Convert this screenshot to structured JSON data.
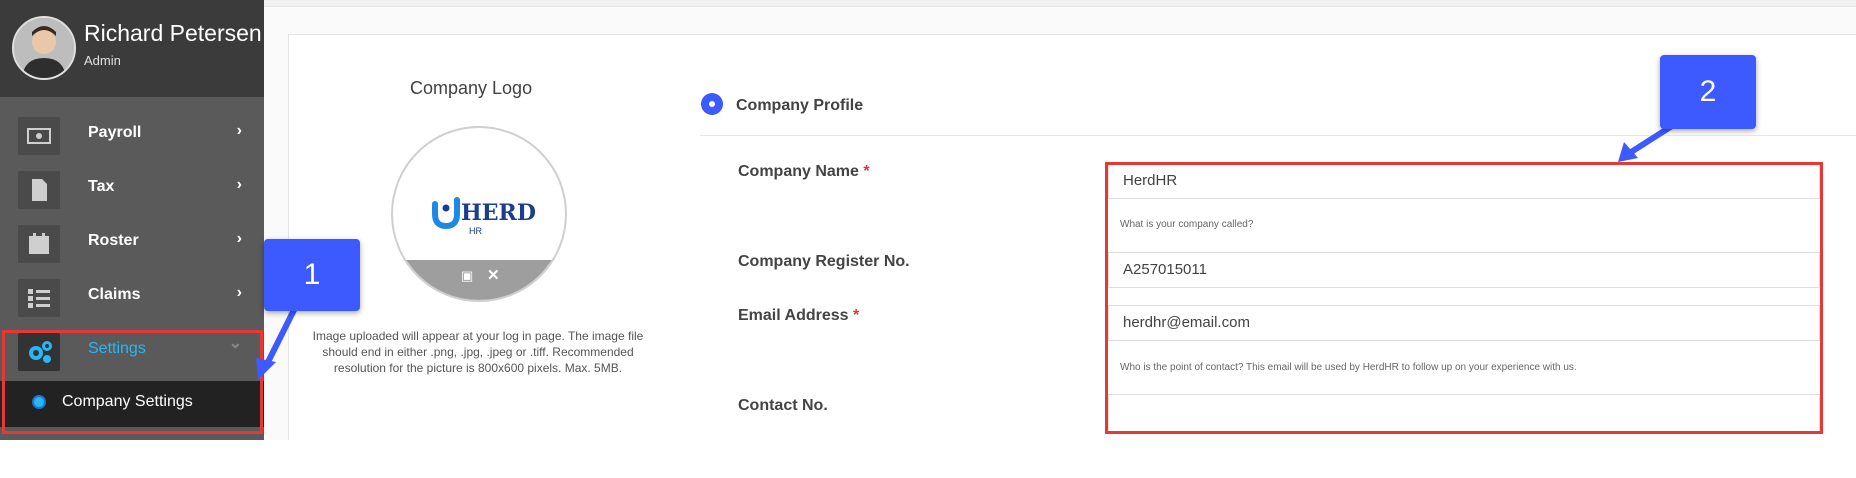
{
  "user": {
    "name": "Richard Petersen",
    "role": "Admin"
  },
  "sidebar": {
    "items": [
      {
        "label": "Payroll",
        "icon": "money-icon",
        "chevron": "›"
      },
      {
        "label": "Tax",
        "icon": "document-icon",
        "chevron": "›"
      },
      {
        "label": "Roster",
        "icon": "calendar-icon",
        "chevron": "›"
      },
      {
        "label": "Claims",
        "icon": "checklist-icon",
        "chevron": "›"
      },
      {
        "label": "Settings",
        "icon": "gears-icon",
        "chevron": "⌄"
      }
    ],
    "sub_item": "Company Settings"
  },
  "logo": {
    "title": "Company Logo",
    "brand_word": "HERD",
    "brand_sub": "HR",
    "help": "Image uploaded will appear at your log in page. The image file should end in either .png, .jpg, .jpeg or .tiff. Recommended resolution for the picture is 800x600 pixels. Max. 5MB."
  },
  "profile": {
    "section_title": "Company Profile",
    "fields": {
      "company_name": {
        "label": "Company Name",
        "required": "*",
        "value": "HerdHR",
        "hint": "What is your company called?"
      },
      "register_no": {
        "label": "Company Register No.",
        "value": "A257015011"
      },
      "email": {
        "label": "Email Address",
        "required": "*",
        "value": "herdhr@email.com",
        "hint": "Who is the point of contact? This email will be used by HerdHR to follow up on your experience with us."
      },
      "contact_no": {
        "label": "Contact No.",
        "value": ""
      }
    }
  },
  "callouts": {
    "one": "1",
    "two": "2"
  },
  "colors": {
    "accent": "#3d5afe",
    "highlight": "#e53935",
    "active_text": "#29b6f6",
    "sidebar": "#5a5a5a"
  }
}
